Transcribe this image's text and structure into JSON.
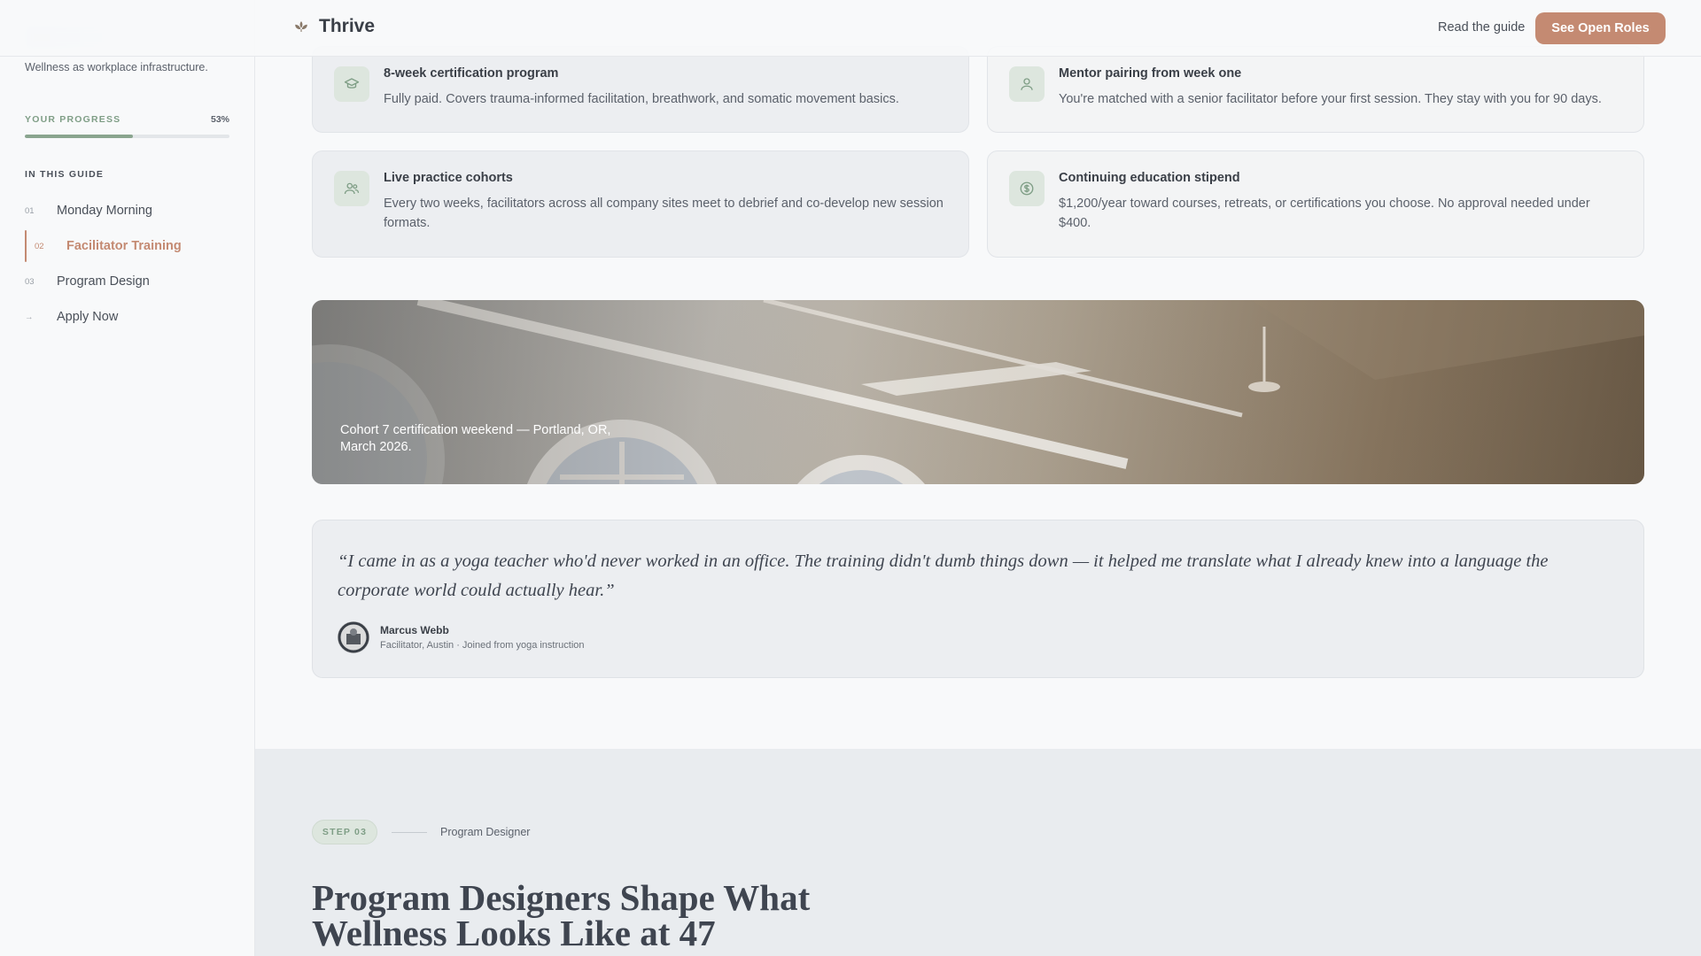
{
  "sidebar": {
    "tagline": "Wellness as workplace infrastructure.",
    "progress_label": "YOUR PROGRESS",
    "progress_text": "53%",
    "progress_value": 0.53,
    "guide_label": "IN THIS GUIDE",
    "items": [
      {
        "num": "01",
        "label": "Monday Morning"
      },
      {
        "num": "02",
        "label": "Facilitator Training"
      },
      {
        "num": "03",
        "label": "Program Design"
      },
      {
        "num": "→",
        "label": "Apply Now"
      }
    ],
    "active_index": 1
  },
  "topbar": {
    "logo_text": "Thrive",
    "logo_icon": "lotus-icon",
    "read_guide": "Read the guide",
    "cta": "See Open Roles"
  },
  "features": [
    {
      "icon": "graduation-cap-icon",
      "title": "8-week certification program",
      "text": "Fully paid. Covers trauma-informed facilitation, breathwork, and somatic movement basics."
    },
    {
      "icon": "user-icon",
      "title": "Mentor pairing from week one",
      "text": "You're matched with a senior facilitator before your first session. They stay with you for 90 days."
    },
    {
      "icon": "users-icon",
      "title": "Live practice cohorts",
      "text": "Every two weeks, facilitators across all company sites meet to debrief and co-develop new session formats."
    },
    {
      "icon": "dollar-icon",
      "title": "Continuing education stipend",
      "text": "$1,200/year toward courses, retreats, or certifications you choose. No approval needed under $400."
    }
  ],
  "photo": {
    "caption": "Cohort 7 certification weekend — Portland, OR, March 2026."
  },
  "quote": {
    "text": "“I came in as a yoga teacher who'd never worked in an office. The training didn't dumb things down — it helped me translate what I already knew into a language the corporate world could actually hear.”",
    "name": "Marcus Webb",
    "role": "Facilitator, Austin · Joined from yoga instruction"
  },
  "section3": {
    "step": "STEP 03",
    "step_title": "Program Designer",
    "heading": "Program Designers Shape What Wellness Looks Like at 47"
  },
  "colors": {
    "accent": "#c48a72",
    "sage": "#8aa58f",
    "text": "#3f4550"
  }
}
